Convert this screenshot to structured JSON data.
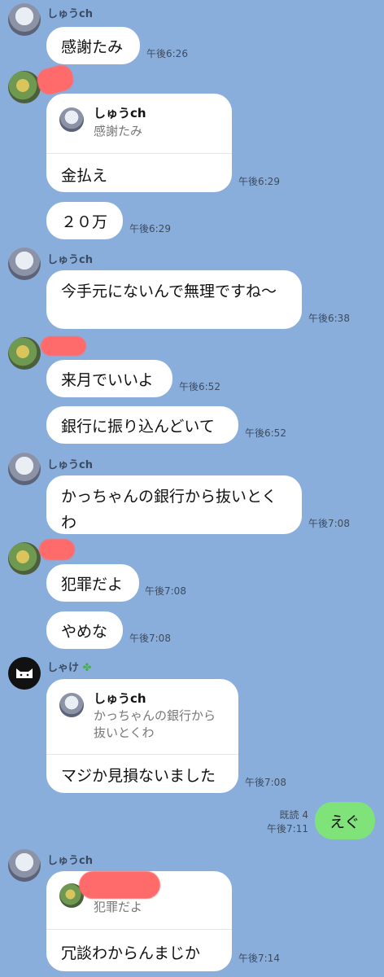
{
  "messages": {
    "m1": {
      "sender": "しゅうch",
      "text": "感謝たみ",
      "time": "午後6:26"
    },
    "m2": {
      "reply_name": "しゅうch",
      "reply_text": "感謝たみ",
      "text": "金払え",
      "time": "午後6:29"
    },
    "m3": {
      "text": "２０万",
      "time": "午後6:29"
    },
    "m4": {
      "sender": "しゅうch",
      "text": "今手元にないんで無理ですね〜",
      "time": "午後6:38"
    },
    "m5": {
      "text": "来月でいいよ",
      "time": "午後6:52"
    },
    "m6": {
      "text": "銀行に振り込んどいて",
      "time": "午後6:52"
    },
    "m7": {
      "sender": "しゅうch",
      "text": "かっちゃんの銀行から抜いとくわ",
      "time": "午後7:08"
    },
    "m8": {
      "text": "犯罪だよ",
      "time": "午後7:08"
    },
    "m9": {
      "text": "やめな",
      "time": "午後7:08"
    },
    "m10": {
      "sender": "しゃけ",
      "sender_icon": "clover-icon",
      "reply_name": "しゅうch",
      "reply_text": "かっちゃんの銀行から抜いとくわ",
      "text": "マジか見損ないました",
      "time": "午後7:08"
    },
    "m11": {
      "read": "既読 4",
      "time": "午後7:11",
      "text": "えぐ"
    },
    "m12": {
      "sender": "しゅうch",
      "reply_text": "犯罪だよ",
      "text": "冗談わからんまじか",
      "time": "午後7:14"
    }
  },
  "colors": {
    "background": "#8aaedc",
    "bubble": "#ffffff",
    "own_bubble": "#80e37a",
    "redaction": "#ff6b6b"
  }
}
